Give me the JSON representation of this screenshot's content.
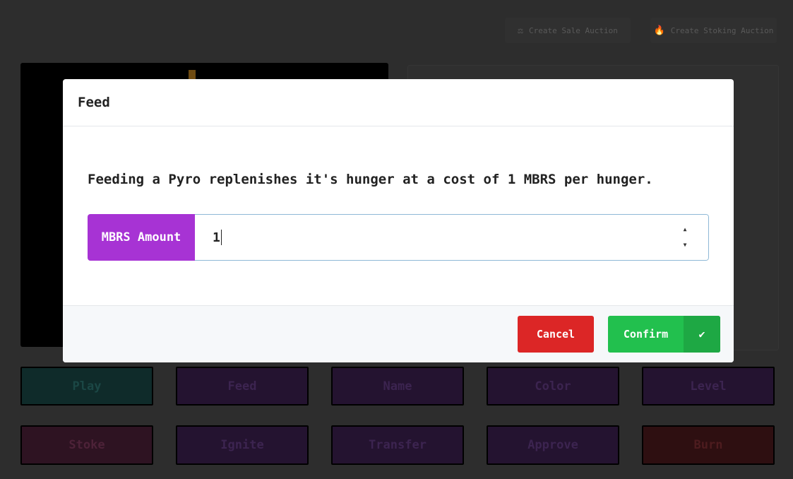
{
  "background": {
    "sale_auction_label": "Create Sale Auction",
    "sale_auction_icon": "⚖",
    "stoking_auction_label": "Create Stoking Auction",
    "stoking_auction_icon": "🔥",
    "actions": [
      "Play",
      "Feed",
      "Name",
      "Color",
      "Level",
      "Stoke",
      "Ignite",
      "Transfer",
      "Approve",
      "Burn"
    ]
  },
  "modal": {
    "title": "Feed",
    "description": "Feeding a Pyro replenishes it's hunger at a cost of 1 MBRS per hunger.",
    "amount_label": "MBRS Amount",
    "amount_value": "1",
    "spinner_up": "▲",
    "spinner_down": "▼",
    "cancel_label": "Cancel",
    "confirm_label": "Confirm",
    "confirm_icon": "✔"
  }
}
